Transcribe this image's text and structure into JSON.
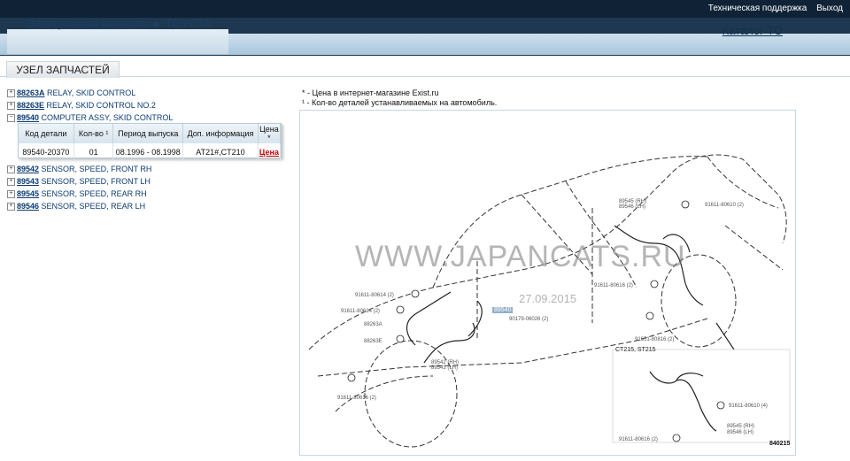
{
  "topbar": {
    "support": "Техническая поддержка",
    "logout": "Выход"
  },
  "breadcrumb": {
    "root": "Электронные каталоги",
    "current": "TOYOTA"
  },
  "header": {
    "catalog_to": "Каталог ТО"
  },
  "tab": {
    "label": "УЗЕЛ ЗАПЧАСТЕЙ"
  },
  "tree": [
    {
      "code": "88263A",
      "name": "RELAY, SKID CONTROL",
      "toggle": "+"
    },
    {
      "code": "88263E",
      "name": "RELAY, SKID CONTROL NO.2",
      "toggle": "+"
    },
    {
      "code": "89540",
      "name": "COMPUTER ASSY, SKID CONTROL",
      "toggle": "−"
    },
    {
      "code": "89542",
      "name": "SENSOR, SPEED, FRONT RH",
      "toggle": "+"
    },
    {
      "code": "89543",
      "name": "SENSOR, SPEED, FRONT LH",
      "toggle": "+"
    },
    {
      "code": "89545",
      "name": "SENSOR, SPEED, REAR RH",
      "toggle": "+"
    },
    {
      "code": "89546",
      "name": "SENSOR, SPEED, REAR LH",
      "toggle": "+"
    }
  ],
  "detail": {
    "headers": [
      "Код детали",
      "Кол-во ¹",
      "Период выпуска",
      "Доп. информация",
      "Цена *"
    ],
    "row": [
      "89540-20370",
      "01",
      "08.1996 - 08.1998",
      "AT21#,CT210",
      "Цена"
    ]
  },
  "notes": {
    "line1": "* - Цена в интернет-магазине Exist.ru",
    "line2": "¹ - Кол-во деталей устанавливаемых на автомобиль."
  },
  "diagram": {
    "watermark": "WWW.JAPANCATS.RU",
    "date": "27.09.2015",
    "highlight_code": "89540",
    "variant_label": "CT215, ST215",
    "figure_number": "840215",
    "labels": {
      "l1": "91611-80614 (2)",
      "l2": "91611-80614 (2)",
      "l3": "88263A",
      "l4": "88263E",
      "l5": "89542 (RH)",
      "l6": "89543 (LH)",
      "l7": "91611-80616 (2)",
      "l8": "89545 (RH)",
      "l9": "89546 (LH)",
      "l10": "91611-80610 (2)",
      "l11": "91611-80616 (2)",
      "l12": "91651-80816 (2)",
      "l13": "90179-06026 (2)",
      "l14": "91611-80610 (4)",
      "l15": "91611-80616 (2)",
      "l16": "89545 (RH)",
      "l17": "89546 (LH)"
    }
  }
}
